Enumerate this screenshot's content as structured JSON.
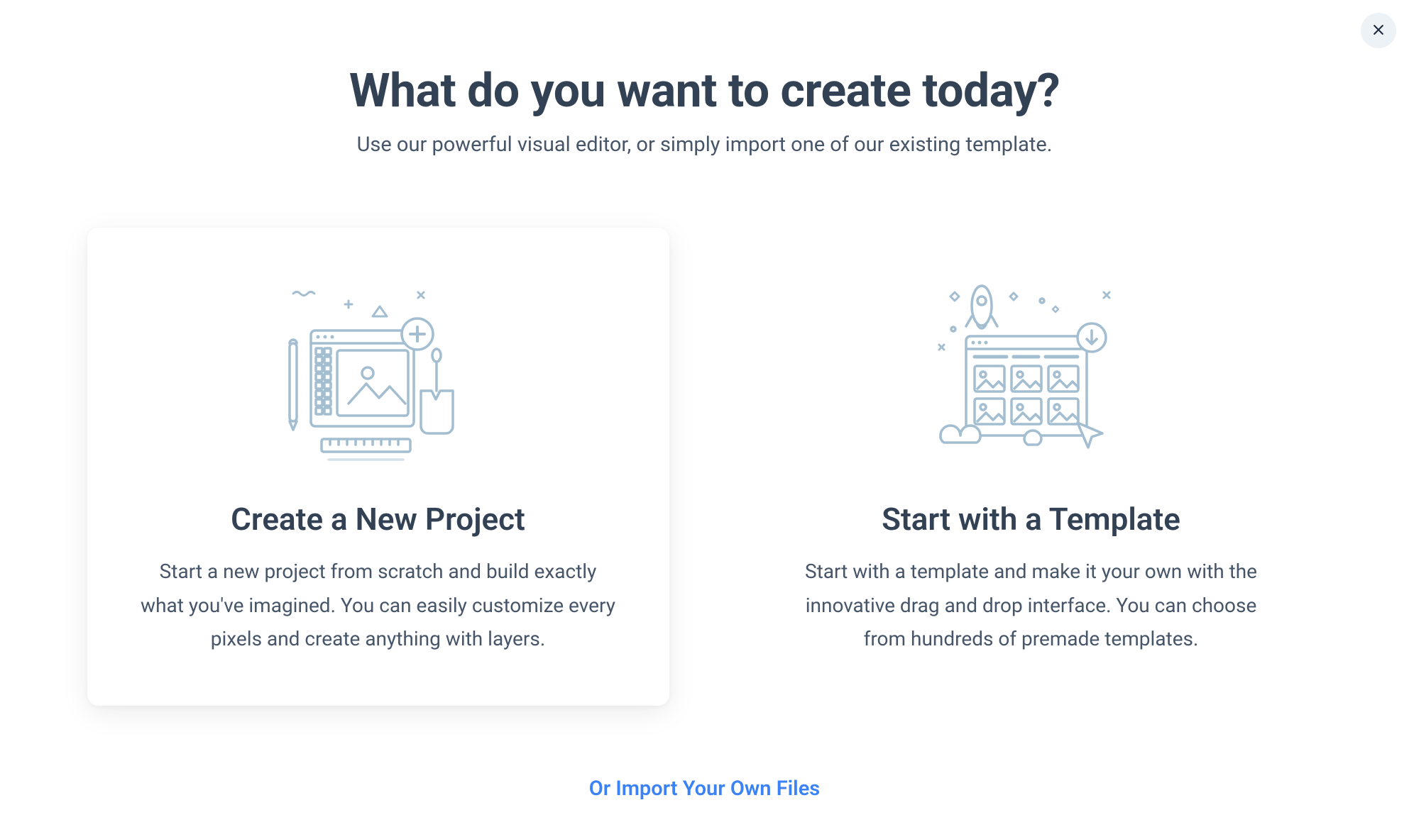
{
  "header": {
    "title": "What do you want to create today?",
    "subtitle": "Use our powerful visual editor, or simply import one of our existing template."
  },
  "cards": {
    "newProject": {
      "title": "Create a New Project",
      "description": "Start a new project from scratch and build exactly what you've imagined. You can easily customize every pixels and create anything with layers."
    },
    "template": {
      "title": "Start with a Template",
      "description": "Start with a template and make it your own with the innovative drag and drop interface. You can choose from hundreds of premade templates."
    }
  },
  "footer": {
    "importLink": "Or Import Your Own Files"
  }
}
